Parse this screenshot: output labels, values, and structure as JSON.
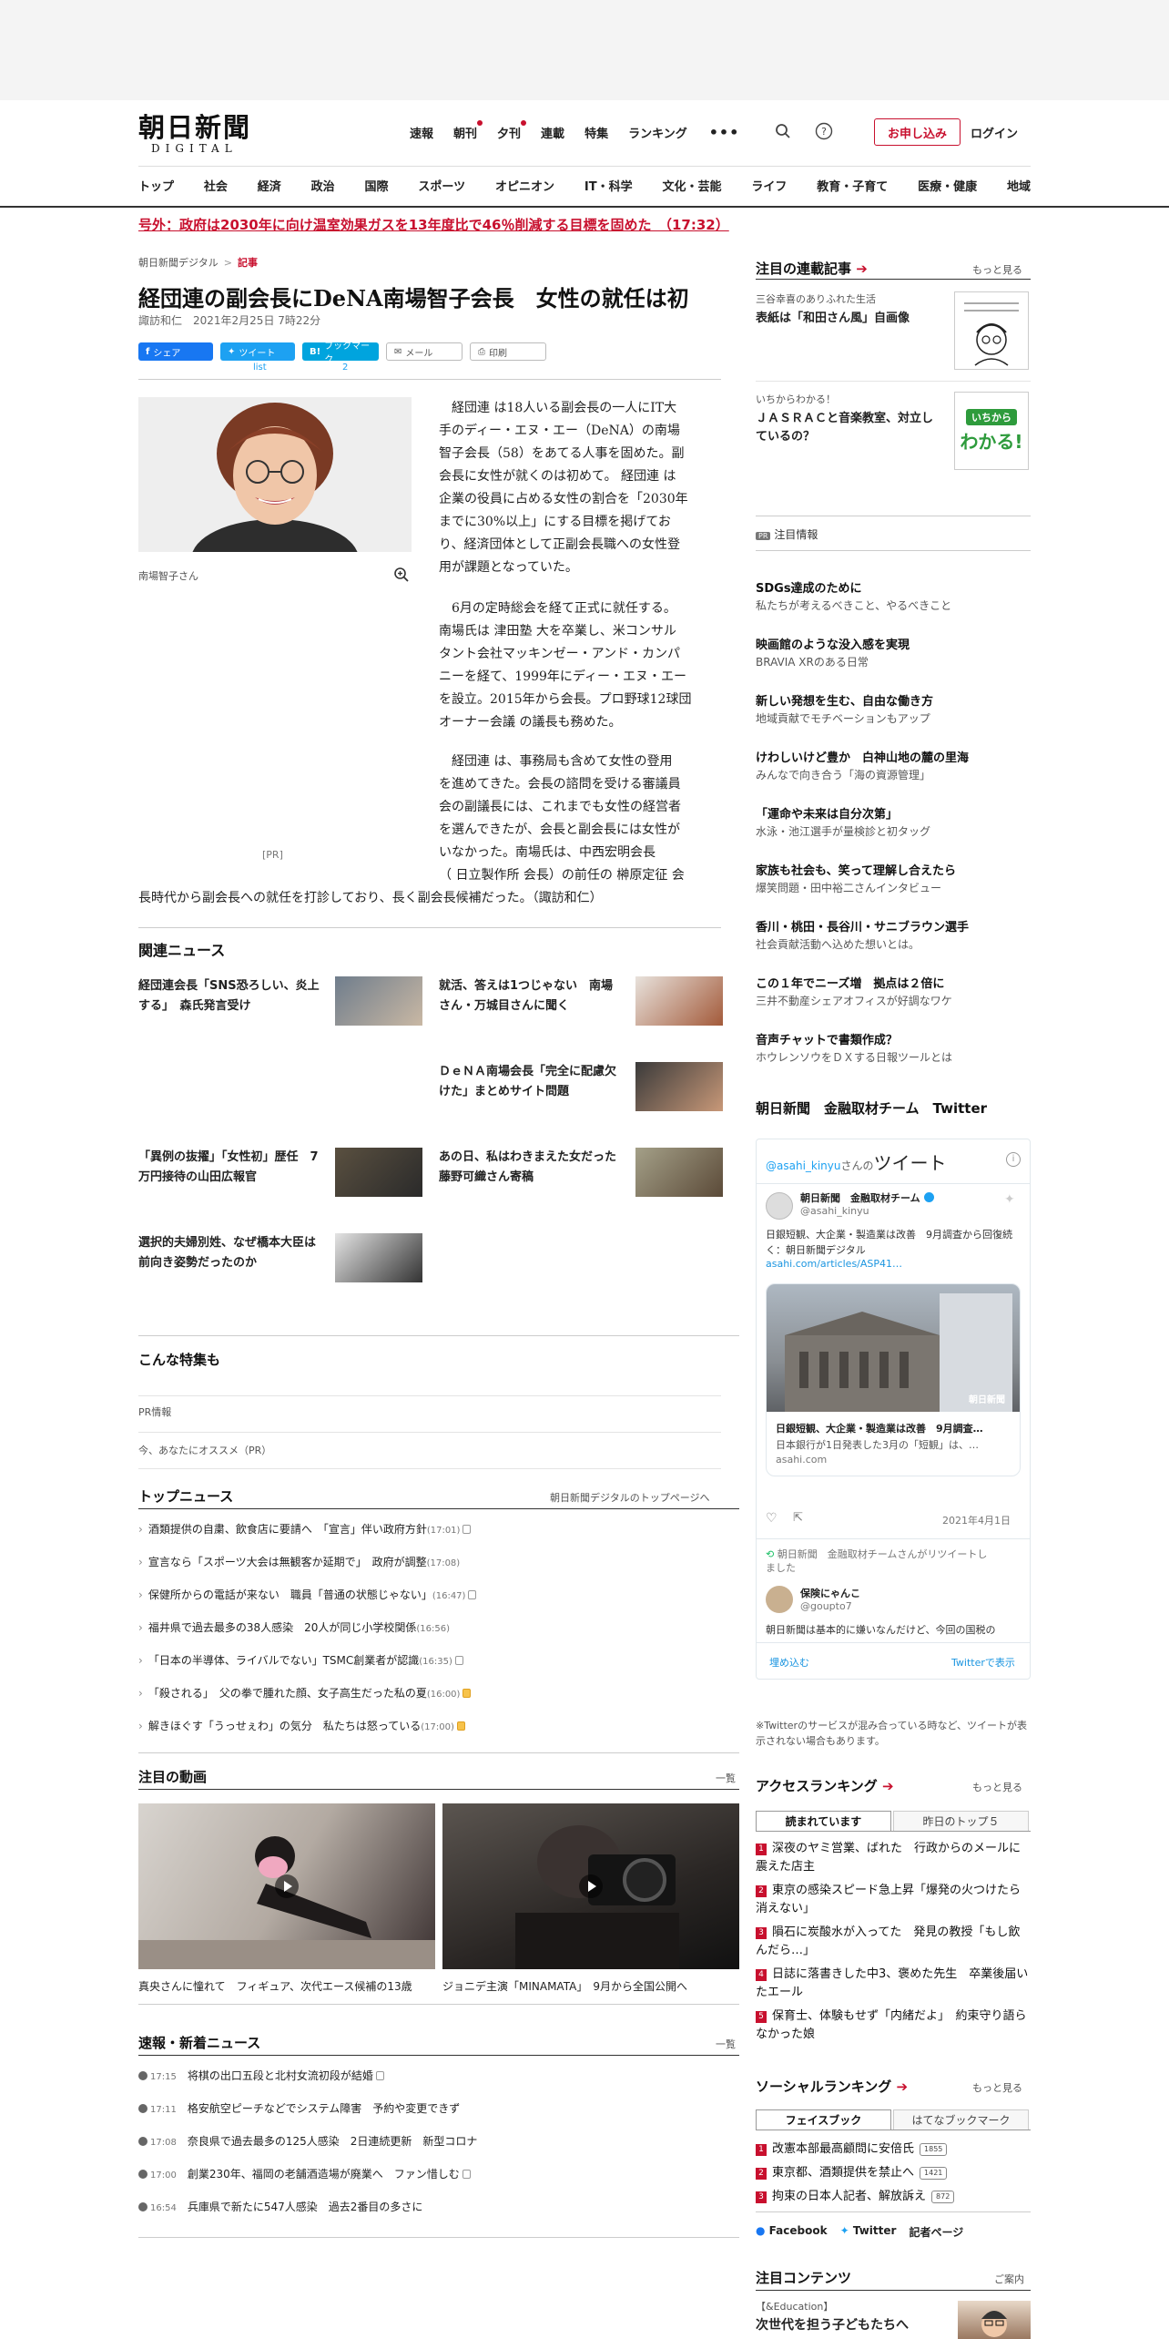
{
  "header": {
    "logo_main": "朝日新聞",
    "logo_sub": "DIGITAL",
    "topnav": [
      "速報",
      "朝刊",
      "夕刊",
      "連載",
      "特集",
      "ランキング"
    ],
    "more": "•••",
    "subscribe": "お申し込み",
    "login": "ログイン",
    "categories": [
      "トップ",
      "社会",
      "経済",
      "政治",
      "国際",
      "スポーツ",
      "オピニオン",
      "IT・科学",
      "文化・芸能",
      "ライフ",
      "教育・子育て",
      "医療・健康",
      "地域"
    ]
  },
  "breaking": "号外：政府は2030年に向け温室効果ガスを13年度比で46％削減する目標を固めた　（17:32）",
  "article": {
    "breadcrumb": [
      "朝日新聞デジタル",
      "記事"
    ],
    "title": "経団連の副会長にDeNA南場智子会長　女性の就任は初",
    "byline": "諏訪和仁　2021年2月25日 7時22分",
    "share": {
      "fb": "シェア",
      "tw": "ツイート",
      "hb": "ブックマーク",
      "mail": "メール",
      "print": "印刷",
      "tw_count": "list",
      "hb_count": "2"
    },
    "photo_caption": "南場智子さん",
    "pr": "[PR]",
    "p1": [
      "　経団連 は18人いる副会長の一人にIT大",
      "手のディー・エヌ・エー（DeNA）の南場",
      "智子会長（58）をあてる人事を固めた。副",
      "会長に女性が就くのは初めて。 経団連 は",
      "企業の役員に占める女性の割合を「2030年",
      "までに30%以上」にする目標を掲げてお",
      "り、経済団体として正副会長職への女性登",
      "用が課題となっていた。"
    ],
    "p2": [
      "　6月の定時総会を経て正式に就任する。",
      "南場氏は 津田塾 大を卒業し、米コンサル",
      "タント会社マッキンゼー・アンド・カンパ",
      "ニーを経て、1999年にディー・エヌ・エー",
      "を設立。2015年から会長。プロ野球12球団",
      "オーナー会議 の議長も務めた。"
    ],
    "p3": [
      "　経団連 は、事務局も含めて女性の登用",
      "を進めてきた。会長の諮問を受ける審議員",
      "会の副議長には、これまでも女性の経営者",
      "を選んできたが、会長と副会長には女性が",
      "いなかった。南場氏は、中西宏明会長",
      "（ 日立製作所 会長）の前任の 榊原定征 会"
    ],
    "p3_last": "長時代から副会長への就任を打診しており、長く副会長候補だった。（諏訪和仁）"
  },
  "related": {
    "title": "関連ニュース",
    "items": [
      "経団連会長「SNS恐ろしい、炎上する」　森氏発言受け",
      "就活、答えは1つじゃない　南場さん・万城目さんに聞く",
      "ＤｅＮＡ南場会長「完全に配慮欠けた」まとめサイト問題",
      "「異例の抜擢」「女性初」歴任　7万円接待の山田広報官",
      "あの日、私はわきまえた女だった　藤野可織さん寄稿",
      "選択的夫婦別姓、なぜ橋本大臣は前向き姿勢だったのか"
    ]
  },
  "feature": {
    "title": "こんな特集も",
    "pr_info": "PR情報",
    "recommend": "今、あなたにオススメ（PR）"
  },
  "top_news": {
    "title": "トップニュース",
    "more": "朝日新聞デジタルのトップページへ",
    "items": [
      {
        "t": "酒類提供の自粛、飲食店に要請へ　「宣言」伴い政府方針",
        "time": "(17:01)",
        "lock": "grey"
      },
      {
        "t": "宣言なら「スポーツ大会は無観客か延期で」　政府が調整",
        "time": "(17:08)",
        "lock": ""
      },
      {
        "t": "保健所からの電話が来ない　職員「普通の状態じゃない」",
        "time": "(16:47)",
        "lock": "grey"
      },
      {
        "t": "福井県で過去最多の38人感染　20人が同じ小学校関係",
        "time": "(16:56)",
        "lock": ""
      },
      {
        "t": "「日本の半導体、ライバルでない」TSMC創業者が認識",
        "time": "(16:35)",
        "lock": "grey"
      },
      {
        "t": "「殺される」　父の拳で腫れた顔、女子高生だった私の夏",
        "time": "(16:00)",
        "lock": "gold"
      },
      {
        "t": "解きほぐす「うっせぇわ」の気分　私たちは怒っている",
        "time": "(17:00)",
        "lock": "gold"
      }
    ]
  },
  "videos": {
    "title": "注目の動画",
    "more": "一覧",
    "captions": [
      "真央さんに憧れて　フィギュア、次代エース候補の13歳",
      "ジョニデ主演「MINAMATA」　9月から全国公開へ"
    ]
  },
  "latest": {
    "title": "速報・新着ニュース",
    "more": "一覧",
    "items": [
      {
        "time": "17:15",
        "t": "将棋の出口五段と北村女流初段が結婚",
        "lock": true
      },
      {
        "time": "17:11",
        "t": "格安航空ピーチなどでシステム障害　予約や変更できず",
        "lock": false
      },
      {
        "time": "17:08",
        "t": "奈良県で過去最多の125人感染　2日連続更新　新型コロナ",
        "lock": false
      },
      {
        "time": "17:00",
        "t": "創業230年、福岡の老舗酒造場が廃業へ　ファン惜しむ",
        "lock": true
      },
      {
        "time": "16:54",
        "t": "兵庫県で新たに547人感染　過去2番目の多さに",
        "lock": false
      }
    ]
  },
  "side": {
    "serial": {
      "title": "注目の連載記事",
      "more": "もっと見る",
      "items": [
        {
          "label": "三谷幸喜のありふれた生活",
          "t": "表紙は「和田さん風」自画像"
        },
        {
          "label": "いちからわかる！",
          "t": "ＪＡＳＲＡＣと音楽教室、対立しているの？"
        }
      ],
      "thumb2": [
        "いちから",
        "わかる!"
      ]
    },
    "pr": {
      "badge": "PR",
      "title": "注目情報",
      "items": [
        {
          "t": "SDGs達成のために",
          "d": "私たちが考えるべきこと、やるべきこと"
        },
        {
          "t": "映画館のような没入感を実現",
          "d": "BRAVIA XRのある日常"
        },
        {
          "t": "新しい発想を生む、自由な働き方",
          "d": "地域貢献でモチベーションもアップ"
        },
        {
          "t": "けわしいけど豊か　白神山地の麓の里海",
          "d": "みんなで向き合う「海の資源管理」"
        },
        {
          "t": "「運命や未来は自分次第」",
          "d": "水泳・池江選手が量検診と初タッグ"
        },
        {
          "t": "家族も社会も、笑って理解し合えたら",
          "d": "爆笑問題・田中裕二さんインタビュー"
        },
        {
          "t": "香川・桃田・長谷川・サニブラウン選手",
          "d": "社会貢献活動へ込めた想いとは。"
        },
        {
          "t": "この１年でニーズ増　拠点は２倍に",
          "d": "三井不動産シェアオフィスが好調なワケ"
        },
        {
          "t": "音声チャットで書類作成？",
          "d": "ホウレンソウをＤＸする日報ツールとは"
        }
      ]
    },
    "twitter": {
      "title": "朝日新聞　金融取材チーム　Twitter",
      "handle_label": "@asahi_kinyu",
      "handle_suffix": "さんの",
      "tweets_word": "ツイート",
      "account": "朝日新聞　金融取材チーム",
      "account_handle": "@asahi_kinyu",
      "tweet_text": "日銀短観、大企業・製造業は改善　9月調査から回復続く：朝日新聞デジタル",
      "tweet_link": "asahi.com/articles/ASP41…",
      "card_title": "日銀短観、大企業・製造業は改善　9月調査…",
      "card_desc": "日本銀行が1日発表した3月の「短観」は、…",
      "card_domain": "asahi.com",
      "watermark": "朝日新聞",
      "date": "2021年4月1日",
      "retweet": "朝日新聞　金融取材チームさんがリツイートしました",
      "rt_name": "保険にゃんこ",
      "rt_handle": "@goupto7",
      "rt_text": "朝日新聞は基本的に嫌いなんだけど、今回の国税の",
      "embed": "埋め込む",
      "view": "Twitterで表示",
      "note": "※Twitterのサービスが混み合っている時など、ツイートが表示されない場合もあります。"
    },
    "access": {
      "title": "アクセスランキング",
      "more": "もっと見る",
      "tabs": [
        "読まれています",
        "昨日のトップ５"
      ],
      "items": [
        "深夜のヤミ営業、ばれた　行政からのメールに震えた店主",
        "東京の感染スピード急上昇「爆発の火つけたら消えない」",
        "隕石に炭酸水が入ってた　発見の教授「もし飲んだら…」",
        "日誌に落書きした中3、褒めた先生　卒業後届いたエール",
        "保育士、体験もせず「内緒だよ」　約束守り語らなかった娘"
      ]
    },
    "social": {
      "title": "ソーシャルランキング",
      "more": "もっと見る",
      "tabs": [
        "フェイスブック",
        "はてなブックマーク"
      ],
      "items": [
        {
          "t": "改憲本部最高顧問に安倍氏",
          "c": "1855"
        },
        {
          "t": "東京都、酒類提供を禁止へ",
          "c": "1421"
        },
        {
          "t": "拘束の日本人記者、解放訴え",
          "c": "872"
        }
      ],
      "links": [
        "Facebook",
        "Twitter",
        "記者ページ"
      ]
    },
    "contents": {
      "title": "注目コンテンツ",
      "more": "ご案内",
      "label": "【&Education】",
      "t": "次世代を担う子どもたちへ"
    }
  }
}
